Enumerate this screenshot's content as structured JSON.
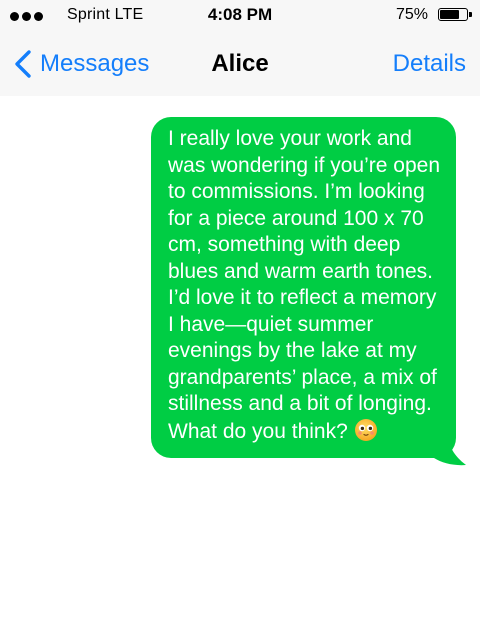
{
  "status_bar": {
    "carrier": "Sprint  LTE",
    "time": "4:08 PM",
    "battery_percent": "75%",
    "battery_level": 0.75
  },
  "nav": {
    "back_label": "Messages",
    "title": "Alice",
    "details_label": "Details"
  },
  "messages": [
    {
      "direction": "outgoing",
      "text": "I really love your work and was wondering if you’re open to commissions. I’m looking for a piece around 100 x 70 cm, something with deep blues and warm earth tones. I’d love it to reflect a memory I have—quiet summer evenings by the lake at my grandparents’ place, a mix of stillness and a bit of longing. What do you think?",
      "emoji": "hopeful-face-icon"
    }
  ],
  "colors": {
    "accent": "#147efb",
    "bubble_outgoing": "#00cd44",
    "bar_background": "#f7f7f7"
  }
}
